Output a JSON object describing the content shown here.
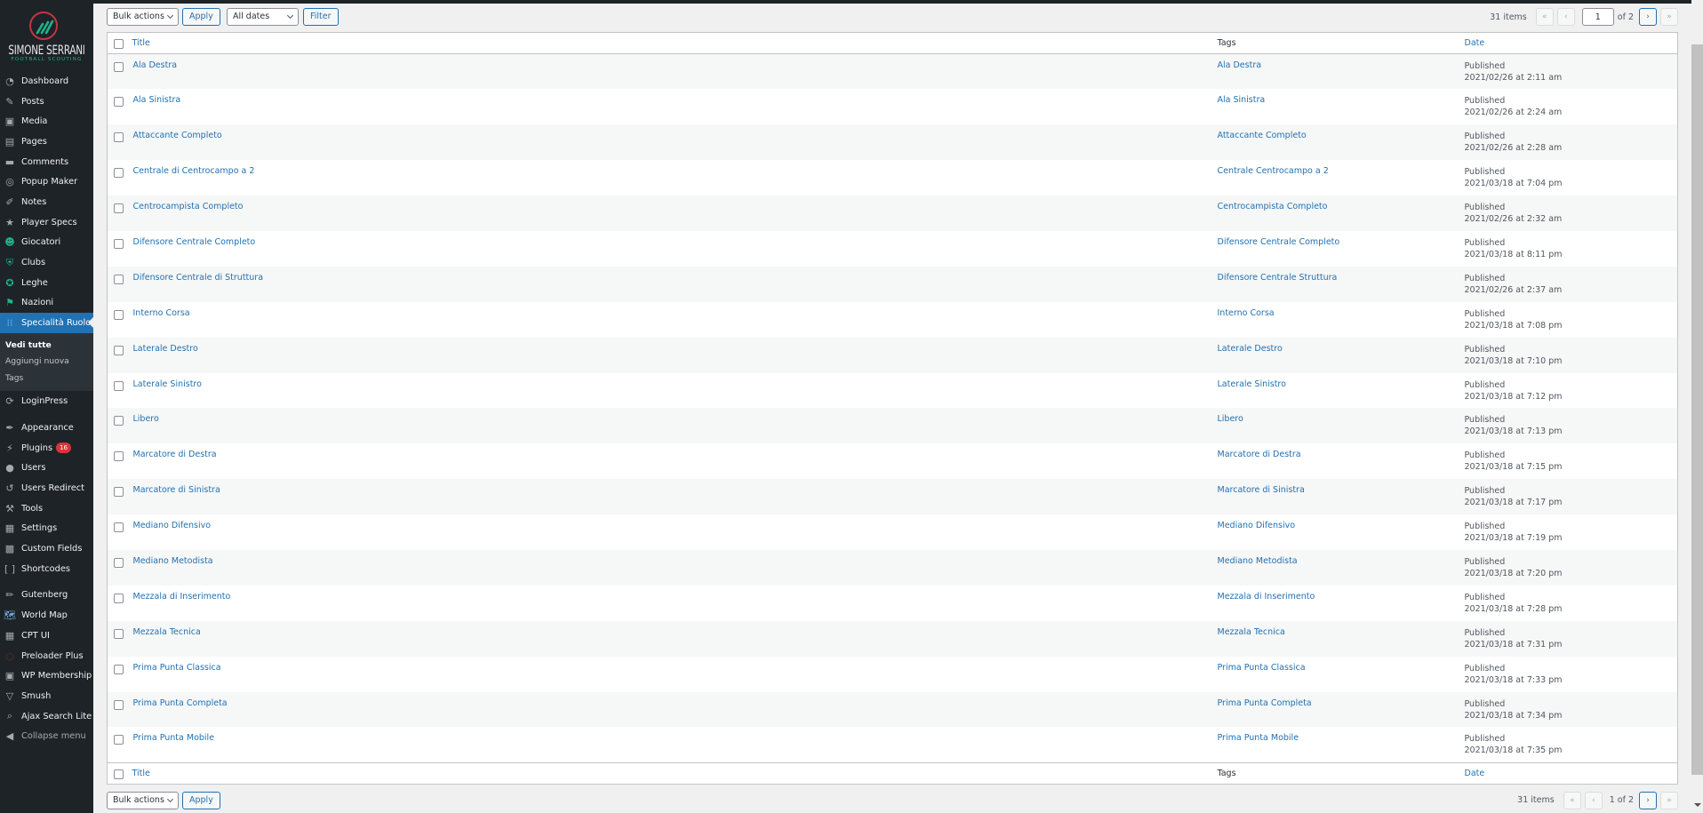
{
  "brand": {
    "name": "SIMONE SERRANI",
    "subtitle": "FOOTBALL SCOUTING",
    "accent": "#1fb48c",
    "ring": "#c0383f"
  },
  "sidebar": {
    "items": [
      {
        "label": "Dashboard",
        "icon": "dashboard-icon",
        "glyph": "◔"
      },
      {
        "label": "Posts",
        "icon": "pin-icon",
        "glyph": "✎"
      },
      {
        "label": "Media",
        "icon": "media-icon",
        "glyph": "▣"
      },
      {
        "label": "Pages",
        "icon": "pages-icon",
        "glyph": "▤"
      },
      {
        "label": "Comments",
        "icon": "comment-icon",
        "glyph": "▬"
      },
      {
        "label": "Popup Maker",
        "icon": "popup-maker-icon",
        "glyph": "◎"
      },
      {
        "label": "Notes",
        "icon": "notes-icon",
        "glyph": "✐"
      },
      {
        "label": "Player Specs",
        "icon": "star-icon",
        "glyph": "★"
      },
      {
        "label": "Giocatori",
        "icon": "player-icon",
        "glyph": "☻"
      },
      {
        "label": "Clubs",
        "icon": "shield-icon",
        "glyph": "⛨"
      },
      {
        "label": "Leghe",
        "icon": "award-icon",
        "glyph": "✪"
      },
      {
        "label": "Nazioni",
        "icon": "flag-icon",
        "glyph": "⚑"
      },
      {
        "label": "Specialità Ruolo",
        "icon": "grid-dots-icon",
        "glyph": "⁞⁞"
      }
    ],
    "submenu": [
      {
        "label": "Vedi tutte",
        "current": true
      },
      {
        "label": "Aggiungi nuova",
        "current": false
      },
      {
        "label": "Tags",
        "current": false
      }
    ],
    "items2": [
      {
        "label": "LoginPress",
        "icon": "loginpress-icon",
        "glyph": "⟳"
      }
    ],
    "items3": [
      {
        "label": "Appearance",
        "icon": "brush-icon",
        "glyph": "✒"
      },
      {
        "label": "Plugins",
        "icon": "plugin-icon",
        "glyph": "⚡",
        "badge": "16"
      },
      {
        "label": "Users",
        "icon": "user-icon",
        "glyph": "●"
      },
      {
        "label": "Users Redirect",
        "icon": "redirect-icon",
        "glyph": "↺"
      },
      {
        "label": "Tools",
        "icon": "wrench-icon",
        "glyph": "⚒"
      },
      {
        "label": "Settings",
        "icon": "settings-icon",
        "glyph": "▦"
      },
      {
        "label": "Custom Fields",
        "icon": "custom-fields-icon",
        "glyph": "▩"
      },
      {
        "label": "Shortcodes",
        "icon": "brackets-icon",
        "glyph": "[ ]"
      }
    ],
    "items4": [
      {
        "label": "Gutenberg",
        "icon": "pencil-icon",
        "glyph": "✏"
      },
      {
        "label": "World Map",
        "icon": "world-map-icon",
        "glyph": "🗺"
      },
      {
        "label": "CPT UI",
        "icon": "cpt-ui-icon",
        "glyph": "▦"
      },
      {
        "label": "Preloader Plus",
        "icon": "preloader-icon",
        "glyph": "○"
      },
      {
        "label": "WP Membership",
        "icon": "membership-icon",
        "glyph": "▣"
      },
      {
        "label": "Smush",
        "icon": "smush-icon",
        "glyph": "▽"
      },
      {
        "label": "Ajax Search Lite",
        "icon": "search-icon",
        "glyph": "⌕"
      }
    ],
    "collapse": {
      "label": "Collapse menu",
      "glyph": "◀"
    }
  },
  "toolbar_top": {
    "bulk_actions": "Bulk actions",
    "apply": "Apply",
    "dates": "All dates",
    "filter": "Filter",
    "items_count": "31 items",
    "first": "«",
    "prev": "‹",
    "current_page": "1",
    "of_pages": "of 2",
    "next": "›",
    "last": "»"
  },
  "toolbar_bottom": {
    "bulk_actions": "Bulk actions",
    "apply": "Apply",
    "items_count": "31 items",
    "first": "«",
    "prev": "‹",
    "page_display": "1 of 2",
    "next": "›",
    "last": "»"
  },
  "table": {
    "columns": {
      "title": "Title",
      "tags": "Tags",
      "date": "Date"
    },
    "rows": [
      {
        "title": "Ala Destra",
        "tags": "Ala Destra",
        "status": "Published",
        "date": "2021/02/26 at 2:11 am"
      },
      {
        "title": "Ala Sinistra",
        "tags": "Ala Sinistra",
        "status": "Published",
        "date": "2021/02/26 at 2:24 am"
      },
      {
        "title": "Attaccante Completo",
        "tags": "Attaccante Completo",
        "status": "Published",
        "date": "2021/02/26 at 2:28 am"
      },
      {
        "title": "Centrale di Centrocampo a 2",
        "tags": "Centrale Centrocampo a 2",
        "status": "Published",
        "date": "2021/03/18 at 7:04 pm"
      },
      {
        "title": "Centrocampista Completo",
        "tags": "Centrocampista Completo",
        "status": "Published",
        "date": "2021/02/26 at 2:32 am"
      },
      {
        "title": "Difensore Centrale Completo",
        "tags": "Difensore Centrale Completo",
        "status": "Published",
        "date": "2021/03/18 at 8:11 pm"
      },
      {
        "title": "Difensore Centrale di Struttura",
        "tags": "Difensore Centrale Struttura",
        "status": "Published",
        "date": "2021/02/26 at 2:37 am"
      },
      {
        "title": "Interno Corsa",
        "tags": "Interno Corsa",
        "status": "Published",
        "date": "2021/03/18 at 7:08 pm"
      },
      {
        "title": "Laterale Destro",
        "tags": "Laterale Destro",
        "status": "Published",
        "date": "2021/03/18 at 7:10 pm"
      },
      {
        "title": "Laterale Sinistro",
        "tags": "Laterale Sinistro",
        "status": "Published",
        "date": "2021/03/18 at 7:12 pm"
      },
      {
        "title": "Libero",
        "tags": "Libero",
        "status": "Published",
        "date": "2021/03/18 at 7:13 pm"
      },
      {
        "title": "Marcatore di Destra",
        "tags": "Marcatore di Destra",
        "status": "Published",
        "date": "2021/03/18 at 7:15 pm"
      },
      {
        "title": "Marcatore di Sinistra",
        "tags": "Marcatore di Sinistra",
        "status": "Published",
        "date": "2021/03/18 at 7:17 pm"
      },
      {
        "title": "Mediano Difensivo",
        "tags": "Mediano Difensivo",
        "status": "Published",
        "date": "2021/03/18 at 7:19 pm"
      },
      {
        "title": "Mediano Metodista",
        "tags": "Mediano Metodista",
        "status": "Published",
        "date": "2021/03/18 at 7:20 pm"
      },
      {
        "title": "Mezzala di Inserimento",
        "tags": "Mezzala di Inserimento",
        "status": "Published",
        "date": "2021/03/18 at 7:28 pm"
      },
      {
        "title": "Mezzala Tecnica",
        "tags": "Mezzala Tecnica",
        "status": "Published",
        "date": "2021/03/18 at 7:31 pm"
      },
      {
        "title": "Prima Punta Classica",
        "tags": "Prima Punta Classica",
        "status": "Published",
        "date": "2021/03/18 at 7:33 pm"
      },
      {
        "title": "Prima Punta Completa",
        "tags": "Prima Punta Completa",
        "status": "Published",
        "date": "2021/03/18 at 7:34 pm"
      },
      {
        "title": "Prima Punta Mobile",
        "tags": "Prima Punta Mobile",
        "status": "Published",
        "date": "2021/03/18 at 7:35 pm"
      }
    ]
  },
  "colors": {
    "link": "#2271b1",
    "sidebar_bg": "#1d2327",
    "active_menu": "#2271b1",
    "badge": "#d63638"
  }
}
